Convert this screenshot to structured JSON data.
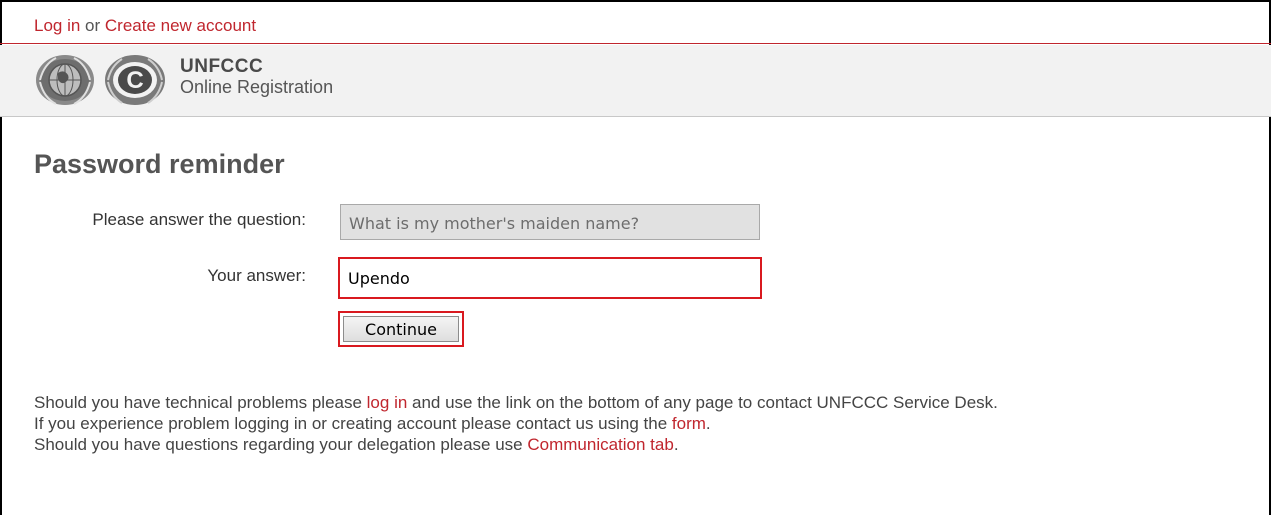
{
  "topbar": {
    "login_link": "Log in",
    "or_text": " or ",
    "create_account_link": "Create new account"
  },
  "header": {
    "brand_title": "UNFCCC",
    "brand_subtitle": "Online Registration"
  },
  "page": {
    "title": "Password reminder"
  },
  "form": {
    "question_label": "Please answer the question:",
    "question_value": "What is my mother's maiden name?",
    "answer_label": "Your answer:",
    "answer_value": "Upendo",
    "continue_label": "Continue"
  },
  "help": {
    "line1_pre": "Should you have technical problems please ",
    "line1_link": "log in",
    "line1_post": " and use the link on the bottom of any page to contact UNFCCC Service Desk.",
    "line2_pre": "If you experience problem logging in or creating account please contact us using the ",
    "line2_link": "form",
    "line2_post": ".",
    "line3_pre": "Should you have questions regarding your delegation please use ",
    "line3_link": "Communication tab",
    "line3_post": "."
  },
  "colors": {
    "accent": "#c0262e",
    "highlight_border": "#d9191f",
    "header_bg": "#f2f2f2"
  }
}
